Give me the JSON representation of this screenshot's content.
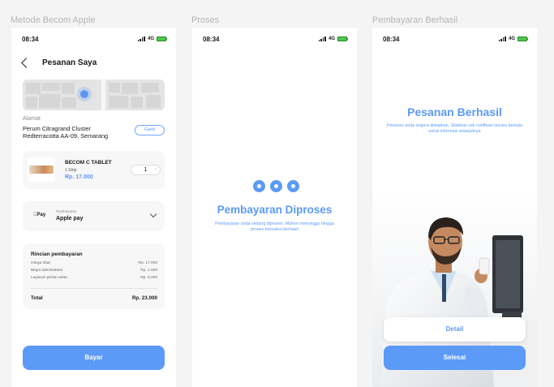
{
  "frames": [
    {
      "label": "Metode Becom Apple"
    },
    {
      "label": "Proses"
    },
    {
      "label": "Pembayaran Berhasil"
    }
  ],
  "status": {
    "time": "08:34",
    "network": "4G"
  },
  "order": {
    "title": "Pesanan Saya",
    "address_label": "Alamat",
    "address": "Perum Citragrand Cluster Redterracotta AA-09, Semarang",
    "change_label": "Ganti",
    "product": {
      "name": "BECOM C TABLET",
      "unit": "1 Strip",
      "price": "Rp. 17.000",
      "quantity": "1"
    },
    "payment": {
      "logo": "Pay",
      "label": "Pembayaran",
      "method": "Apple pay"
    },
    "breakdown": {
      "title": "Rincian pembayaran",
      "rows": [
        {
          "label": "Harga obat",
          "value": "Rp. 17.000"
        },
        {
          "label": "Biaya administrasi",
          "value": "Rp. 1.000"
        },
        {
          "label": "Layanan pesan antar",
          "value": "Rp. 5.000"
        }
      ],
      "total_label": "Total",
      "total_value": "Rp. 23.000"
    },
    "pay_button": "Bayar"
  },
  "processing": {
    "title": "Pembayaran Diproses",
    "subtitle": "Pembayaran anda sedang diproses. Mohon menunggu hingga proses transaksi berhasil"
  },
  "success": {
    "title": "Pesanan Berhasil",
    "subtitle": "Pesanan anda segera disiapkan. Silahkan cek notifikasi secara berkala untuk informasi selanjutnya",
    "detail_button": "Detail",
    "done_button": "Selesai"
  },
  "colors": {
    "accent": "#5b9af7",
    "background": "#f4f4f4"
  }
}
